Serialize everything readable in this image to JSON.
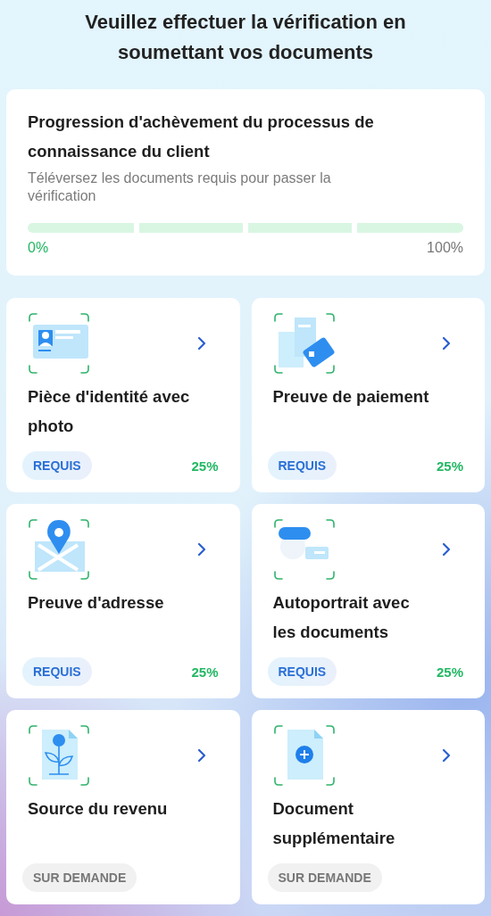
{
  "heading": "Veuillez effectuer la vérification en soumettant vos documents",
  "progress": {
    "title": "Progression d'achèvement du processus de connaissance du client",
    "subtitle": "Téléversez les documents requis pour passer la vérification",
    "level": 0,
    "start": "0%",
    "end": "100%"
  },
  "documents": [
    {
      "kind": "id",
      "title": "Pièce d'identité avec photo",
      "badge": {
        "kind": "required",
        "label": "REQUIS"
      },
      "percent": "25%"
    },
    {
      "kind": "payment",
      "title": "Preuve de paiement",
      "badge": {
        "kind": "required",
        "label": "REQUIS"
      },
      "percent": "25%"
    },
    {
      "kind": "address",
      "title": "Preuve d'adresse",
      "badge": {
        "kind": "required",
        "label": "REQUIS"
      },
      "percent": "25%"
    },
    {
      "kind": "selfie",
      "title": "Autoportrait avec les documents",
      "badge": {
        "kind": "required",
        "label": "REQUIS"
      },
      "percent": "25%"
    },
    {
      "kind": "income",
      "title": "Source du revenu",
      "badge": {
        "kind": "on_request",
        "label": "SUR DEMANDE"
      }
    },
    {
      "kind": "additional",
      "title": "Document supplémentaire",
      "badge": {
        "kind": "on_request",
        "label": "SUR DEMANDE"
      }
    }
  ]
}
